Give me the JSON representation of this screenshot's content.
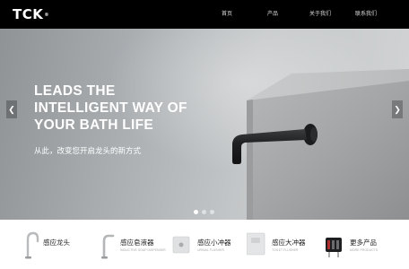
{
  "header": {
    "logo": "TCK",
    "logo_mark": "®",
    "nav": [
      {
        "label": "首页"
      },
      {
        "label": "产品"
      },
      {
        "label": "关于我们"
      },
      {
        "label": "联系我们"
      }
    ]
  },
  "hero": {
    "title_lines": [
      "LEADS THE",
      "INTELLIGENT WAY OF",
      "YOUR BATH LIFE"
    ],
    "subtitle": "从此，改变您开启龙头的新方式",
    "prev_icon": "chevron-left-icon",
    "next_icon": "chevron-right-icon",
    "slides_count": 3,
    "active_slide": 1
  },
  "products": [
    {
      "name": "感应龙头",
      "desc": "",
      "icon": "faucet-icon"
    },
    {
      "name": "感应皂液器",
      "desc": "INDUCTIVE SOAP DISPENSER",
      "icon": "soap-dispenser-icon"
    },
    {
      "name": "感应小冲器",
      "desc": "URINAL FLUSHER",
      "icon": "urinal-flusher-icon"
    },
    {
      "name": "感应大冲器",
      "desc": "TOILET FLUSHER",
      "icon": "toilet-flusher-icon"
    },
    {
      "name": "更多产品",
      "desc": "MORE PRODUCTS",
      "icon": "more-products-icon"
    }
  ],
  "colors": {
    "header_bg": "#000000",
    "text_light": "#ffffff",
    "product_text": "#222222"
  }
}
